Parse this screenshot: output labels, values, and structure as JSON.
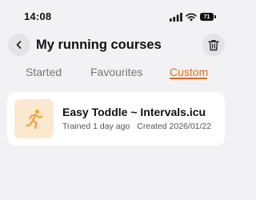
{
  "status_bar": {
    "time": "14:08",
    "battery_level": "71",
    "icons": [
      "signal-icon",
      "wifi-icon",
      "battery-icon"
    ]
  },
  "header": {
    "title": "My running courses",
    "back_icon": "chevron-left-icon",
    "delete_icon": "trash-icon"
  },
  "tabs": [
    {
      "label": "Started",
      "active": false
    },
    {
      "label": "Favourites",
      "active": false
    },
    {
      "label": "Custom",
      "active": true
    }
  ],
  "courses": [
    {
      "name": "Easy Toddle ~ Intervals.icu",
      "trained": "Trained 1 day ago",
      "created": "Created 2026/01/22",
      "thumbnail_icon": "runner-icon"
    }
  ],
  "colors": {
    "accent": "#e36a1c",
    "background": "#f2f2f4",
    "card": "#ffffff",
    "thumbnail_bg": "#fbe8cf"
  }
}
